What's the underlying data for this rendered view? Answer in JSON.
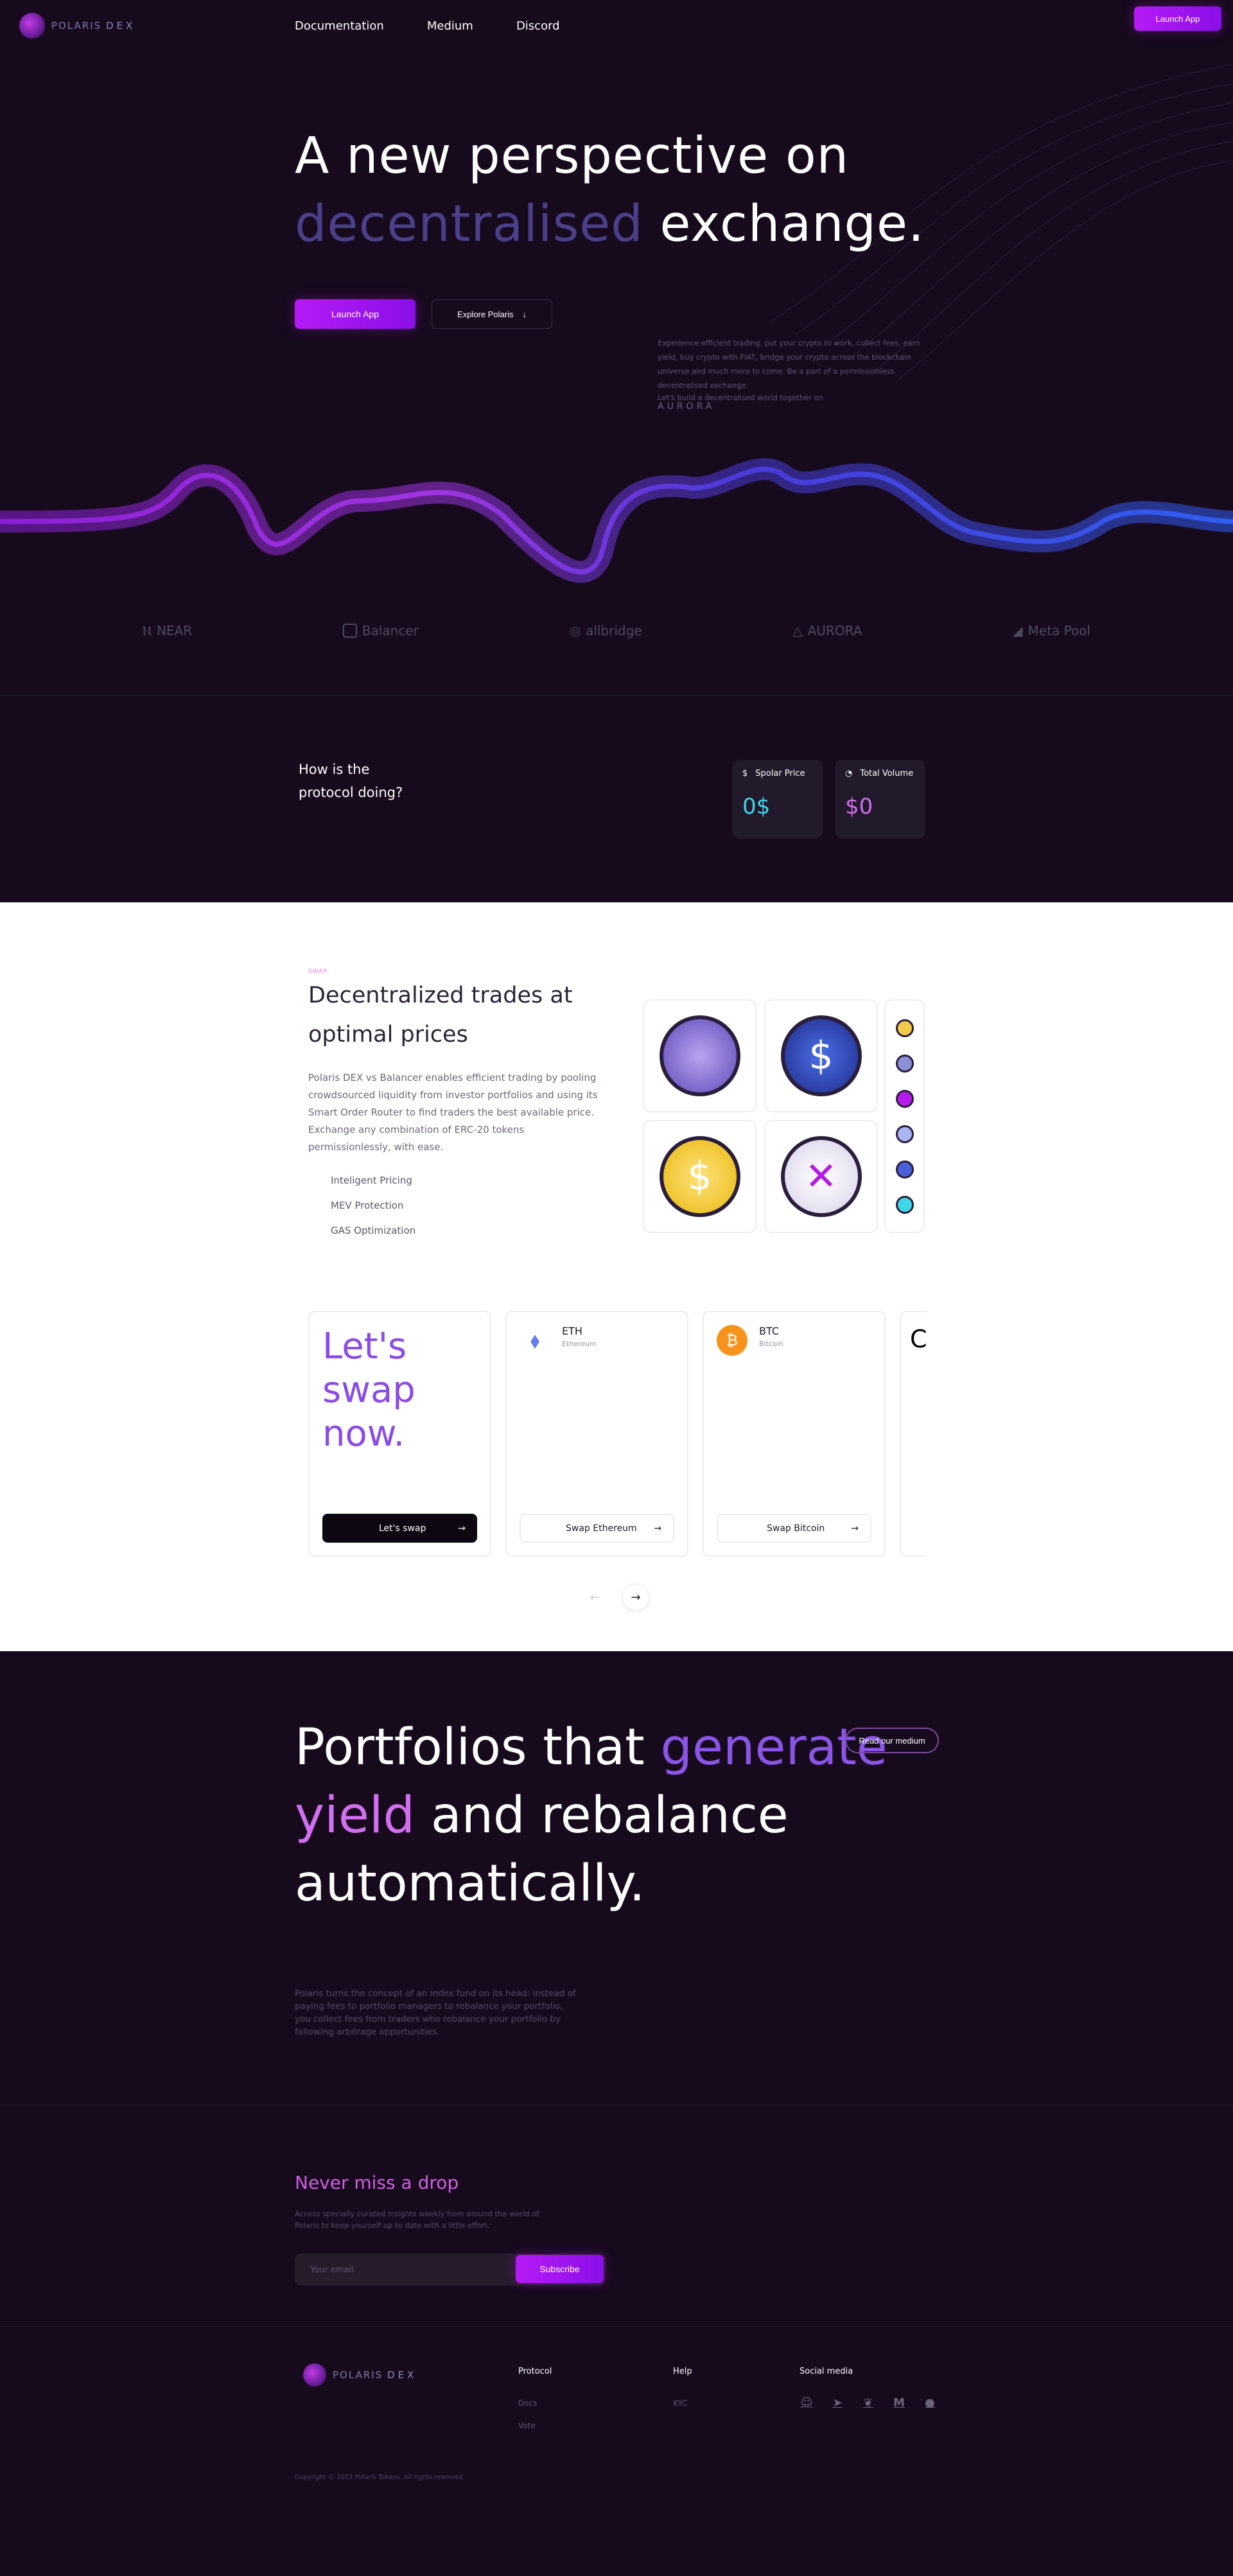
{
  "header": {
    "logo_word": "POLARIS",
    "logo_suffix": "DEX",
    "nav": [
      "Documentation",
      "Medium",
      "Discord"
    ],
    "launch_label": "Launch App"
  },
  "hero": {
    "title_line1": "A new perspective on",
    "title_accent": "decentralised",
    "title_rest": "exchange.",
    "launch_label": "Launch App",
    "explore_label": "Explore Polaris",
    "description": "Experience efficient trading, put your crypto to work, collect fees, earn yield, buy crypto with FIAT, bridge your crypto across the blockchain universe and much more to come. Be a part of a permissionless decentralised exchange.",
    "tagline": "Let's build a decentralised world together on",
    "tagline_brand": "AURORA"
  },
  "partners": [
    "NEAR",
    "Balancer",
    "allbridge",
    "AURORA",
    "Meta Pool"
  ],
  "stats": {
    "question": "How is the protocol doing?",
    "cards": [
      {
        "label": "Spolar Price",
        "value": "0$",
        "icon": "dollar-icon",
        "color": "#3fd6e8"
      },
      {
        "label": "Total Volume",
        "value": "$0",
        "icon": "pie-chart-icon",
        "color": "#d36ef0"
      }
    ]
  },
  "swap": {
    "label": "SWAP",
    "title": "Decentralized trades at optimal prices",
    "description": "Polaris DEX vs Balancer enables efficient trading by pooling crowdsourced liquidity from investor portfolios and using its Smart Order Router to find traders the best available price. Exchange any combination of ERC-20 tokens permissionlessly, with ease.",
    "features": [
      "Inteligent Pricing",
      "MEV Protection",
      "GAS Optimization"
    ]
  },
  "cards": {
    "cta_title": "Let's swap now.",
    "cta_button": "Let's swap",
    "tokens": [
      {
        "symbol": "ETH",
        "name": "Ethereum",
        "button": "Swap Ethereum",
        "icon": "ethereum-icon",
        "color": "#627eea"
      },
      {
        "symbol": "BTC",
        "name": "Bitcoin",
        "button": "Swap Bitcoin",
        "icon": "bitcoin-icon",
        "color": "#f7931a"
      }
    ]
  },
  "portfolio": {
    "t1": "Portfolios that",
    "t2": "generate",
    "t3": "yield",
    "t4": "and rebalance",
    "t5": "automatically.",
    "medium_label": "Read our medium",
    "description": "Polaris turns the concept of an index fund on its head: instead of paying fees to portfolio managers to rebalance your portfolio, you collect fees from traders who rebalance your portfolio by following arbitrage opportunities."
  },
  "newsletter": {
    "title": "Never miss a drop",
    "description": "Access specially curated insights weekly from around the world of Polaris to keep yourself up to date with a little effort.",
    "email_placeholder": "Your email",
    "subscribe_label": "Subscribe"
  },
  "footer": {
    "protocol_heading": "Protocol",
    "protocol_links": [
      "Docs",
      "Vote"
    ],
    "help_heading": "Help",
    "help_links": [
      "KYC"
    ],
    "social_heading": "Social media",
    "social_icons": [
      "discord-icon",
      "telegram-icon",
      "twitter-icon",
      "medium-icon",
      "github-icon"
    ],
    "copyright": "Copyright © 2022 Polaris Tokens. All rights reserved."
  },
  "colors": {
    "accent": "#b61bf5",
    "background": "#170a1d",
    "spolar_cyan": "#3fd6e8",
    "volume_pink": "#d36ef0"
  }
}
